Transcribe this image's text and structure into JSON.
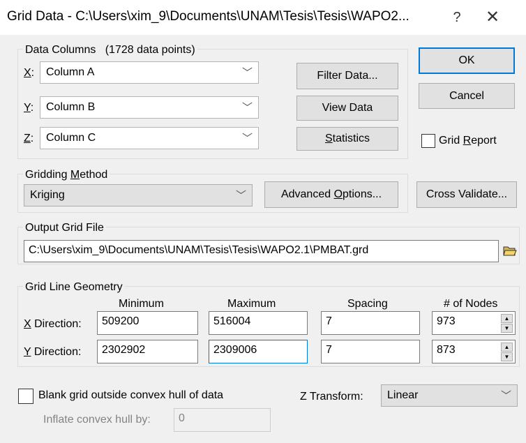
{
  "window": {
    "title": "Grid Data - C:\\Users\\xim_9\\Documents\\UNAM\\Tesis\\Tesis\\WAPO2...",
    "help_glyph": "?",
    "close_glyph": "✕"
  },
  "data_columns": {
    "label": "Data Columns",
    "count_text": "(1728 data points)",
    "x": {
      "label_key": "X",
      "label_rest": ":",
      "value": "Column A"
    },
    "y": {
      "label_key": "Y",
      "label_rest": ":",
      "value": "Column B"
    },
    "z": {
      "label_key": "Z",
      "label_rest": ":",
      "value": "Column C"
    },
    "filter_button": "Filter Data...",
    "view_button": "View Data",
    "stats_button_key": "S",
    "stats_button_rest": "tatistics"
  },
  "buttons": {
    "ok": "OK",
    "cancel": "Cancel",
    "grid_report_pre": "Grid ",
    "grid_report_key": "R",
    "grid_report_post": "eport"
  },
  "gridding": {
    "label_pre": "Gridding ",
    "label_key": "M",
    "label_post": "ethod",
    "method": "Kriging",
    "advanced_pre": "Advanced ",
    "advanced_key": "O",
    "advanced_post": "ptions...",
    "cross_validate": "Cross Validate..."
  },
  "output": {
    "label": "Output Grid File",
    "path": "C:\\Users\\xim_9\\Documents\\UNAM\\Tesis\\Tesis\\WAPO2.1\\PMBAT.grd",
    "browse_icon": "folder-open-icon"
  },
  "geometry": {
    "label": "Grid Line Geometry",
    "headers": {
      "minimum": "Minimum",
      "maximum": "Maximum",
      "spacing": "Spacing",
      "nodes": "# of Nodes"
    },
    "x_dir": {
      "key": "X",
      "rest": " Direction:",
      "minimum": "509200",
      "maximum": "516004",
      "spacing": "7",
      "nodes": "973"
    },
    "y_dir": {
      "key": "Y",
      "rest": " Direction:",
      "minimum": "2302902",
      "maximum": "2309006",
      "spacing": "7",
      "nodes": "873"
    }
  },
  "blank": {
    "label": "Blank grid outside convex hull of data",
    "inflate_label": "Inflate convex hull by:",
    "inflate_value": "0"
  },
  "ztransform": {
    "label": "Z Transform:",
    "value": "Linear"
  },
  "colors": {
    "accent": "#0078d7",
    "window_bg": "#f0f0f0"
  }
}
